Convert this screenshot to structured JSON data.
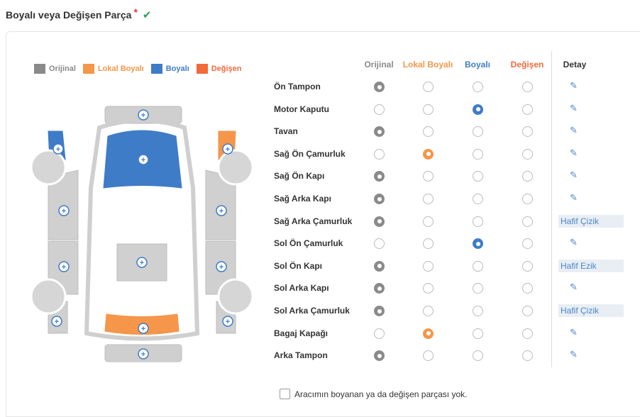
{
  "header": {
    "title": "Boyalı veya Değişen Parça",
    "required_mark": "*"
  },
  "legend": [
    {
      "label": "Orijinal",
      "color": "#8a8a8a"
    },
    {
      "label": "Lokal Boyalı",
      "color": "#f5964a"
    },
    {
      "label": "Boyalı",
      "color": "#3f7cc8"
    },
    {
      "label": "Değişen",
      "color": "#f06a3c"
    }
  ],
  "columns": [
    {
      "label": "Orijinal",
      "color": "#8a8a8a"
    },
    {
      "label": "Lokal Boyalı",
      "color": "#f5964a"
    },
    {
      "label": "Boyalı",
      "color": "#3f7cc8"
    },
    {
      "label": "Değişen",
      "color": "#f06a3c"
    }
  ],
  "detail_header": "Detay",
  "parts": [
    {
      "label": "Ön Tampon",
      "selected": 0,
      "detail": ""
    },
    {
      "label": "Motor Kaputu",
      "selected": 2,
      "detail": ""
    },
    {
      "label": "Tavan",
      "selected": 0,
      "detail": ""
    },
    {
      "label": "Sağ Ön Çamurluk",
      "selected": 1,
      "detail": ""
    },
    {
      "label": "Sağ Ön Kapı",
      "selected": 0,
      "detail": ""
    },
    {
      "label": "Sağ Arka Kapı",
      "selected": 0,
      "detail": ""
    },
    {
      "label": "Sağ Arka Çamurluk",
      "selected": 0,
      "detail": "Hafif Çizik"
    },
    {
      "label": "Sol Ön Çamurluk",
      "selected": 2,
      "detail": ""
    },
    {
      "label": "Sol Ön Kapı",
      "selected": 0,
      "detail": "Hafif Ezik"
    },
    {
      "label": "Sol Arka Kapı",
      "selected": 0,
      "detail": ""
    },
    {
      "label": "Sol Arka Çamurluk",
      "selected": 0,
      "detail": "Hafif Çizik"
    },
    {
      "label": "Bagaj Kapağı",
      "selected": 1,
      "detail": ""
    },
    {
      "label": "Arka Tampon",
      "selected": 0,
      "detail": ""
    }
  ],
  "no_change_label": "Aracımın boyanan ya da değişen parçası yok."
}
